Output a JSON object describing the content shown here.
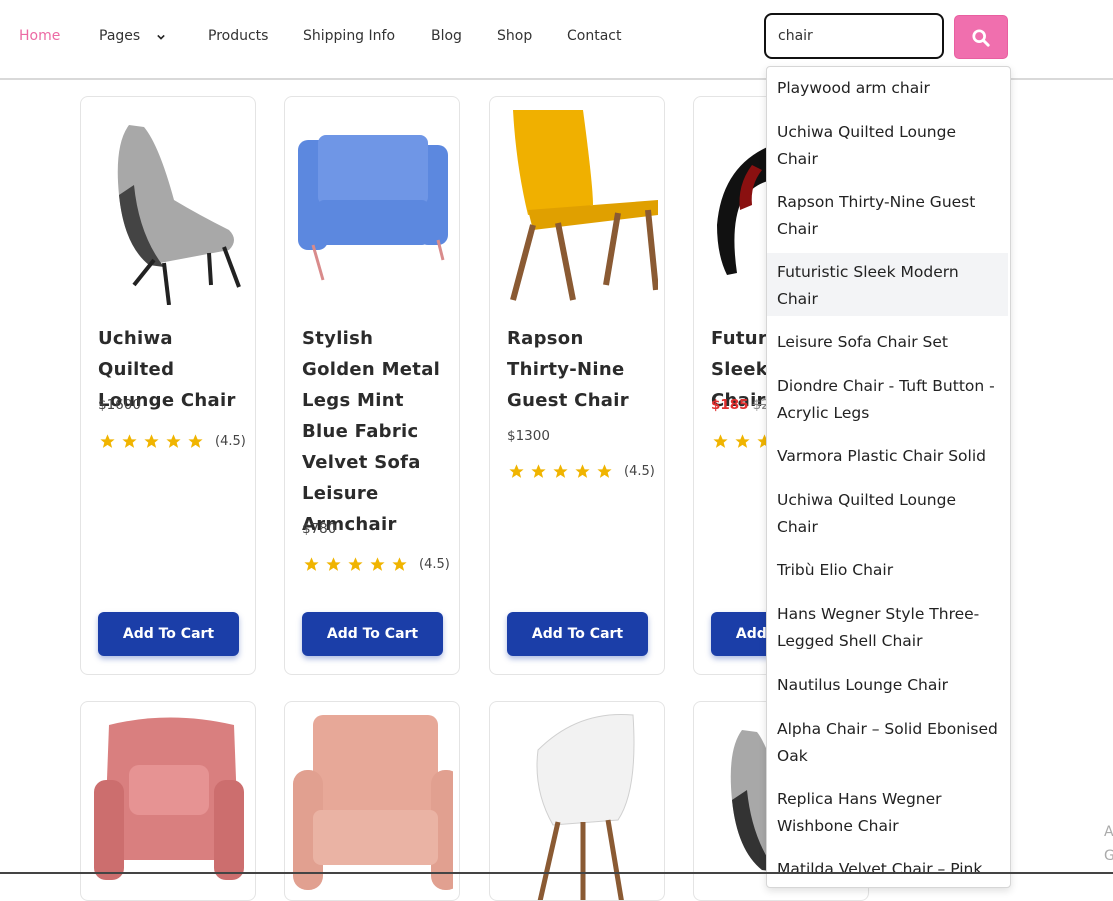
{
  "nav": {
    "home": "Home",
    "pages": "Pages",
    "products": "Products",
    "shipping": "Shipping Info",
    "blog": "Blog",
    "shop": "Shop",
    "contact": "Contact"
  },
  "search": {
    "value": "chair"
  },
  "products": [
    {
      "title": "Uchiwa Quilted Lounge Chair",
      "price": "$1600",
      "rating": "(4.5)",
      "cart": "Add To Cart"
    },
    {
      "title": "Stylish Golden Metal Legs Mint Blue Fabric Velvet Sofa Leisure Armchair",
      "price": "$780",
      "rating": "(4.5)",
      "cart": "Add To Cart"
    },
    {
      "title": "Rapson Thirty-Nine Guest Chair",
      "price": "$1300",
      "rating": "(4.5)",
      "cart": "Add To Cart"
    },
    {
      "title": "Futuristic Sleek Modern Chair",
      "sale_price": "$185",
      "old_price": "$2",
      "cart": "Add To Cart"
    }
  ],
  "dropdown": [
    "Playwood arm chair",
    "Uchiwa Quilted Lounge Chair",
    "Rapson Thirty-Nine Guest Chair",
    "Futuristic Sleek Modern Chair",
    "Leisure Sofa Chair Set",
    "Diondre Chair - Tuft Button - Acrylic Legs",
    "Varmora Plastic Chair Solid",
    "Uchiwa Quilted Lounge Chair",
    "Tribù Elio Chair",
    "Hans Wegner Style Three-Legged Shell Chair",
    "Nautilus Lounge Chair",
    "Alpha Chair – Solid Ebonised Oak",
    "Replica Hans Wegner Wishbone Chair",
    "Matilda Velvet Chair – Pink"
  ],
  "edge": {
    "a": "A",
    "g": "G"
  },
  "colors": {
    "accent_pink": "#f06fae",
    "cart_blue": "#1b3ea8",
    "star": "#f0b400",
    "sale_red": "#e0302f"
  }
}
